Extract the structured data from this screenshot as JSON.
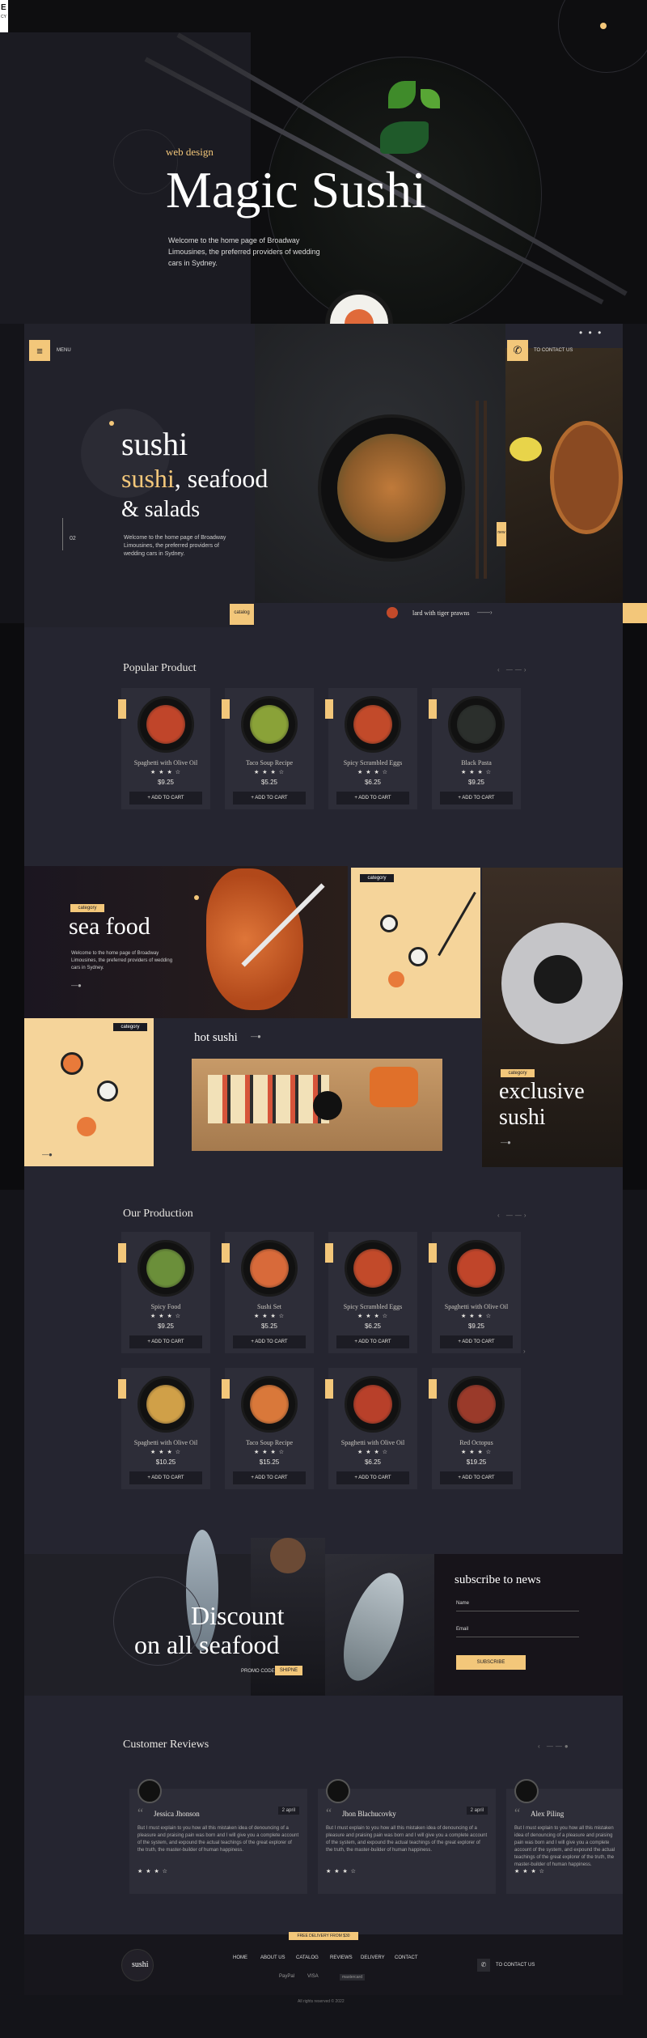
{
  "hero": {
    "tag_letter": "E",
    "tag_sub": "CY",
    "kicker": "web design",
    "title": "Magic Sushi",
    "description": "Welcome to the home page of Broadway Limousines, the preferred providers of wedding cars in Sydney."
  },
  "header": {
    "menu_label": "MENU",
    "contact_label": "TO CONTACT US"
  },
  "banner": {
    "word1": "sushi",
    "word2": "sushi",
    "word2_rest": ", seafood",
    "word3": "& salads",
    "description": "Welcome to the home page of Broadway Limousines, the preferred providers of wedding cars in Sydney.",
    "slide_number": "02",
    "catalog_label": "catalog",
    "dish_caption": "lard with tiger prawns",
    "side_tag": "new"
  },
  "popular": {
    "title": "Popular Product",
    "add_to_cart": "+ ADD TO CART",
    "items": [
      {
        "name": "Spaghetti with Olive Oil",
        "stars": "★ ★ ★ ☆",
        "price": "$9.25",
        "color": "#c0452a"
      },
      {
        "name": "Taco Soup Recipe",
        "stars": "★ ★ ★ ☆",
        "price": "$5.25",
        "color": "#8aa238"
      },
      {
        "name": "Spicy Scrambled Eggs",
        "stars": "★ ★ ★ ☆",
        "price": "$6.25",
        "color": "#c24a2a"
      },
      {
        "name": "Black Pasta",
        "stars": "★ ★ ★ ☆",
        "price": "$9.25",
        "color": "#2b2f2c"
      }
    ]
  },
  "categories": {
    "seafood_tag": "category",
    "seafood_title": "sea food",
    "seafood_desc": "Welcome to the home page of Broadway Limousines, the preferred providers of wedding cars in Sydney.",
    "sushi_tag": "category",
    "hot_title": "hot sushi",
    "left_tag": "category",
    "exclusive_tag": "category",
    "exclusive_title_1": "exclusive",
    "exclusive_title_2": "sushi"
  },
  "production": {
    "title": "Our Production",
    "add_to_cart": "+ ADD TO CART",
    "items": [
      {
        "name": "Spicy Food",
        "stars": "★ ★ ★ ☆",
        "price": "$9.25",
        "color": "#6b8f3a"
      },
      {
        "name": "Sushi Set",
        "stars": "★ ★ ★ ☆",
        "price": "$5.25",
        "color": "#d86a3a"
      },
      {
        "name": "Spicy Scrambled Eggs",
        "stars": "★ ★ ★ ☆",
        "price": "$6.25",
        "color": "#c24a2a"
      },
      {
        "name": "Spaghetti with Olive Oil",
        "stars": "★ ★ ★ ☆",
        "price": "$9.25",
        "color": "#c0452a"
      },
      {
        "name": "Spaghetti with Olive Oil",
        "stars": "★ ★ ★ ☆",
        "price": "$10.25",
        "color": "#d0a048"
      },
      {
        "name": "Taco Soup Recipe",
        "stars": "★ ★ ★ ☆",
        "price": "$15.25",
        "color": "#d9783a"
      },
      {
        "name": "Spaghetti with Olive Oil",
        "stars": "★ ★ ★ ☆",
        "price": "$6.25",
        "color": "#b8402a"
      },
      {
        "name": "Red Octopus",
        "stars": "★ ★ ★ ☆",
        "price": "$19.25",
        "color": "#9a3a2a"
      }
    ]
  },
  "promo": {
    "line1": "Discount",
    "line2": "on all seafood",
    "promo_label": "PROMO CODE",
    "promo_code": "SHIPNE",
    "subscribe_title": "subscribe to news",
    "name_label": "Name",
    "email_label": "Email",
    "button": "SUBSCRIBE"
  },
  "reviews": {
    "title": "Customer Reviews",
    "items": [
      {
        "name": "Jessica Jhonson",
        "date": "2 april",
        "text": "But I must explain to you how all this mistaken idea of denouncing of a pleasure and praising pain was born and I will give you a complete account of the system, and expound the actual teachings of the great explorer of the truth, the master-builder of human happiness.",
        "stars": "★ ★ ★ ☆"
      },
      {
        "name": "Jhon Blachucovky",
        "date": "2 april",
        "text": "But I must explain to you how all this mistaken idea of denouncing of a pleasure and praising pain was born and I will give you a complete account of the system, and expound the actual teachings of the great explorer of the truth, the master-builder of human happiness.",
        "stars": "★ ★ ★ ☆"
      },
      {
        "name": "Alex Piling",
        "date": "",
        "text": "But I must explain to you how all this mistaken idea of denouncing of a pleasure and praising pain was born and I will give you a complete account of the system, and expound the actual teachings of the great explorer of the truth, the master-builder of human happiness.",
        "stars": "★ ★ ★ ☆"
      }
    ]
  },
  "footer": {
    "delivery_banner": "FREE DELIVERY FROM $30",
    "logo": "sushi",
    "nav": [
      "HOME",
      "ABOUT US",
      "CATALOG",
      "REVIEWS",
      "DELIVERY",
      "CONTACT"
    ],
    "pay1": "PayPal",
    "pay2": "VISA",
    "pay3": "mastercard",
    "contact": "TO CONTACT US",
    "copyright": "All rights reserved © 2022"
  }
}
